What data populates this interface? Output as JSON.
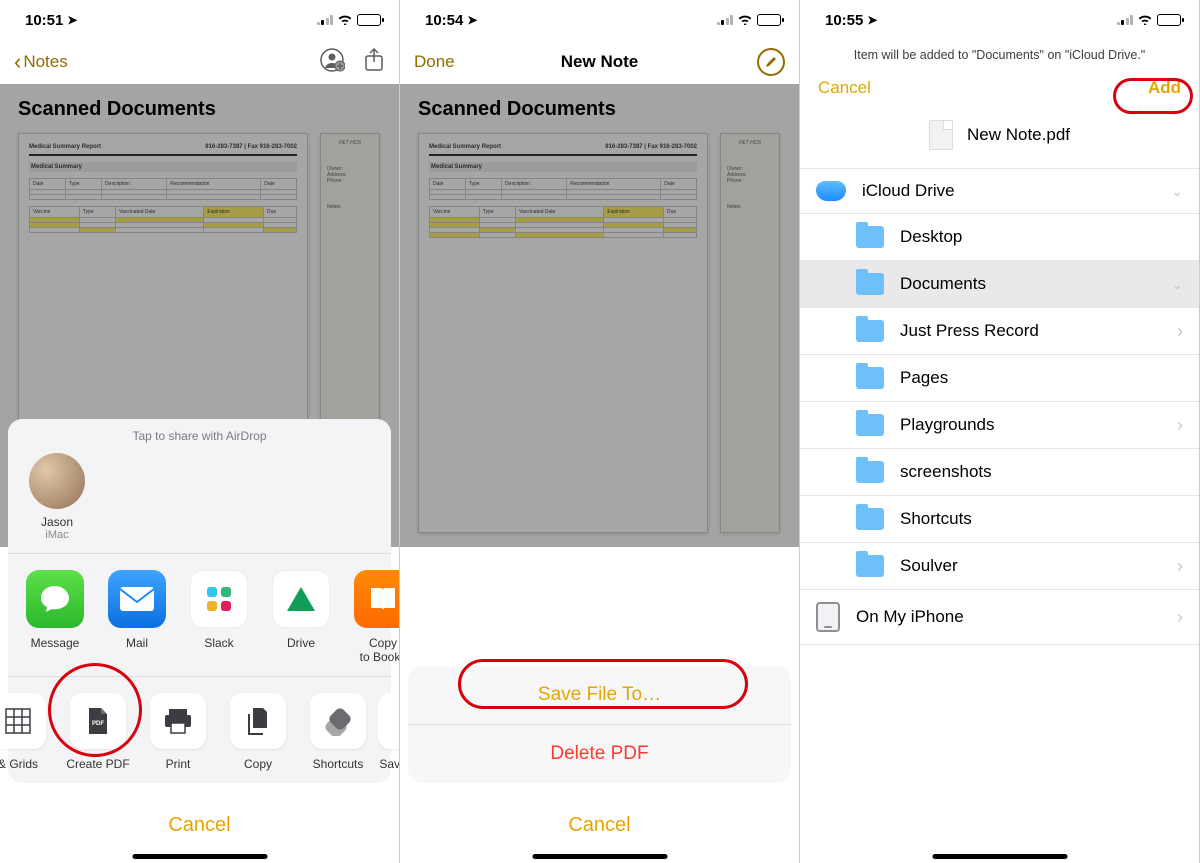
{
  "screen1": {
    "status": {
      "time": "10:51"
    },
    "nav": {
      "back": "Notes"
    },
    "note": {
      "title": "Scanned Documents"
    },
    "share": {
      "airdrop_label": "Tap to share with AirDrop",
      "airdrop": {
        "name": "Jason",
        "device": "iMac"
      },
      "apps": [
        {
          "label": "Message"
        },
        {
          "label": "Mail"
        },
        {
          "label": "Slack"
        },
        {
          "label": "Drive"
        },
        {
          "label": "Copy\nto Books"
        }
      ],
      "actions_left_clip": "& Grids",
      "actions": [
        {
          "label": "Create PDF"
        },
        {
          "label": "Print"
        },
        {
          "label": "Copy"
        },
        {
          "label": "Shortcuts"
        }
      ],
      "actions_right_clip": "Save",
      "cancel": "Cancel"
    }
  },
  "screen2": {
    "status": {
      "time": "10:54"
    },
    "nav": {
      "done": "Done",
      "title": "New Note"
    },
    "note": {
      "title": "Scanned Documents"
    },
    "menu": {
      "save": "Save File To…",
      "delete": "Delete PDF",
      "cancel": "Cancel"
    }
  },
  "screen3": {
    "status": {
      "time": "10:55"
    },
    "subtitle": "Item will be added to \"Documents\" on \"iCloud Drive.\"",
    "nav": {
      "cancel": "Cancel",
      "add": "Add"
    },
    "file": {
      "name": "New Note.pdf"
    },
    "locations": {
      "icloud": "iCloud Drive",
      "folders": [
        "Desktop",
        "Documents",
        "Just Press Record",
        "Pages",
        "Playgrounds",
        "screenshots",
        "Shortcuts",
        "Soulver"
      ],
      "onmyiphone": "On My iPhone"
    }
  }
}
